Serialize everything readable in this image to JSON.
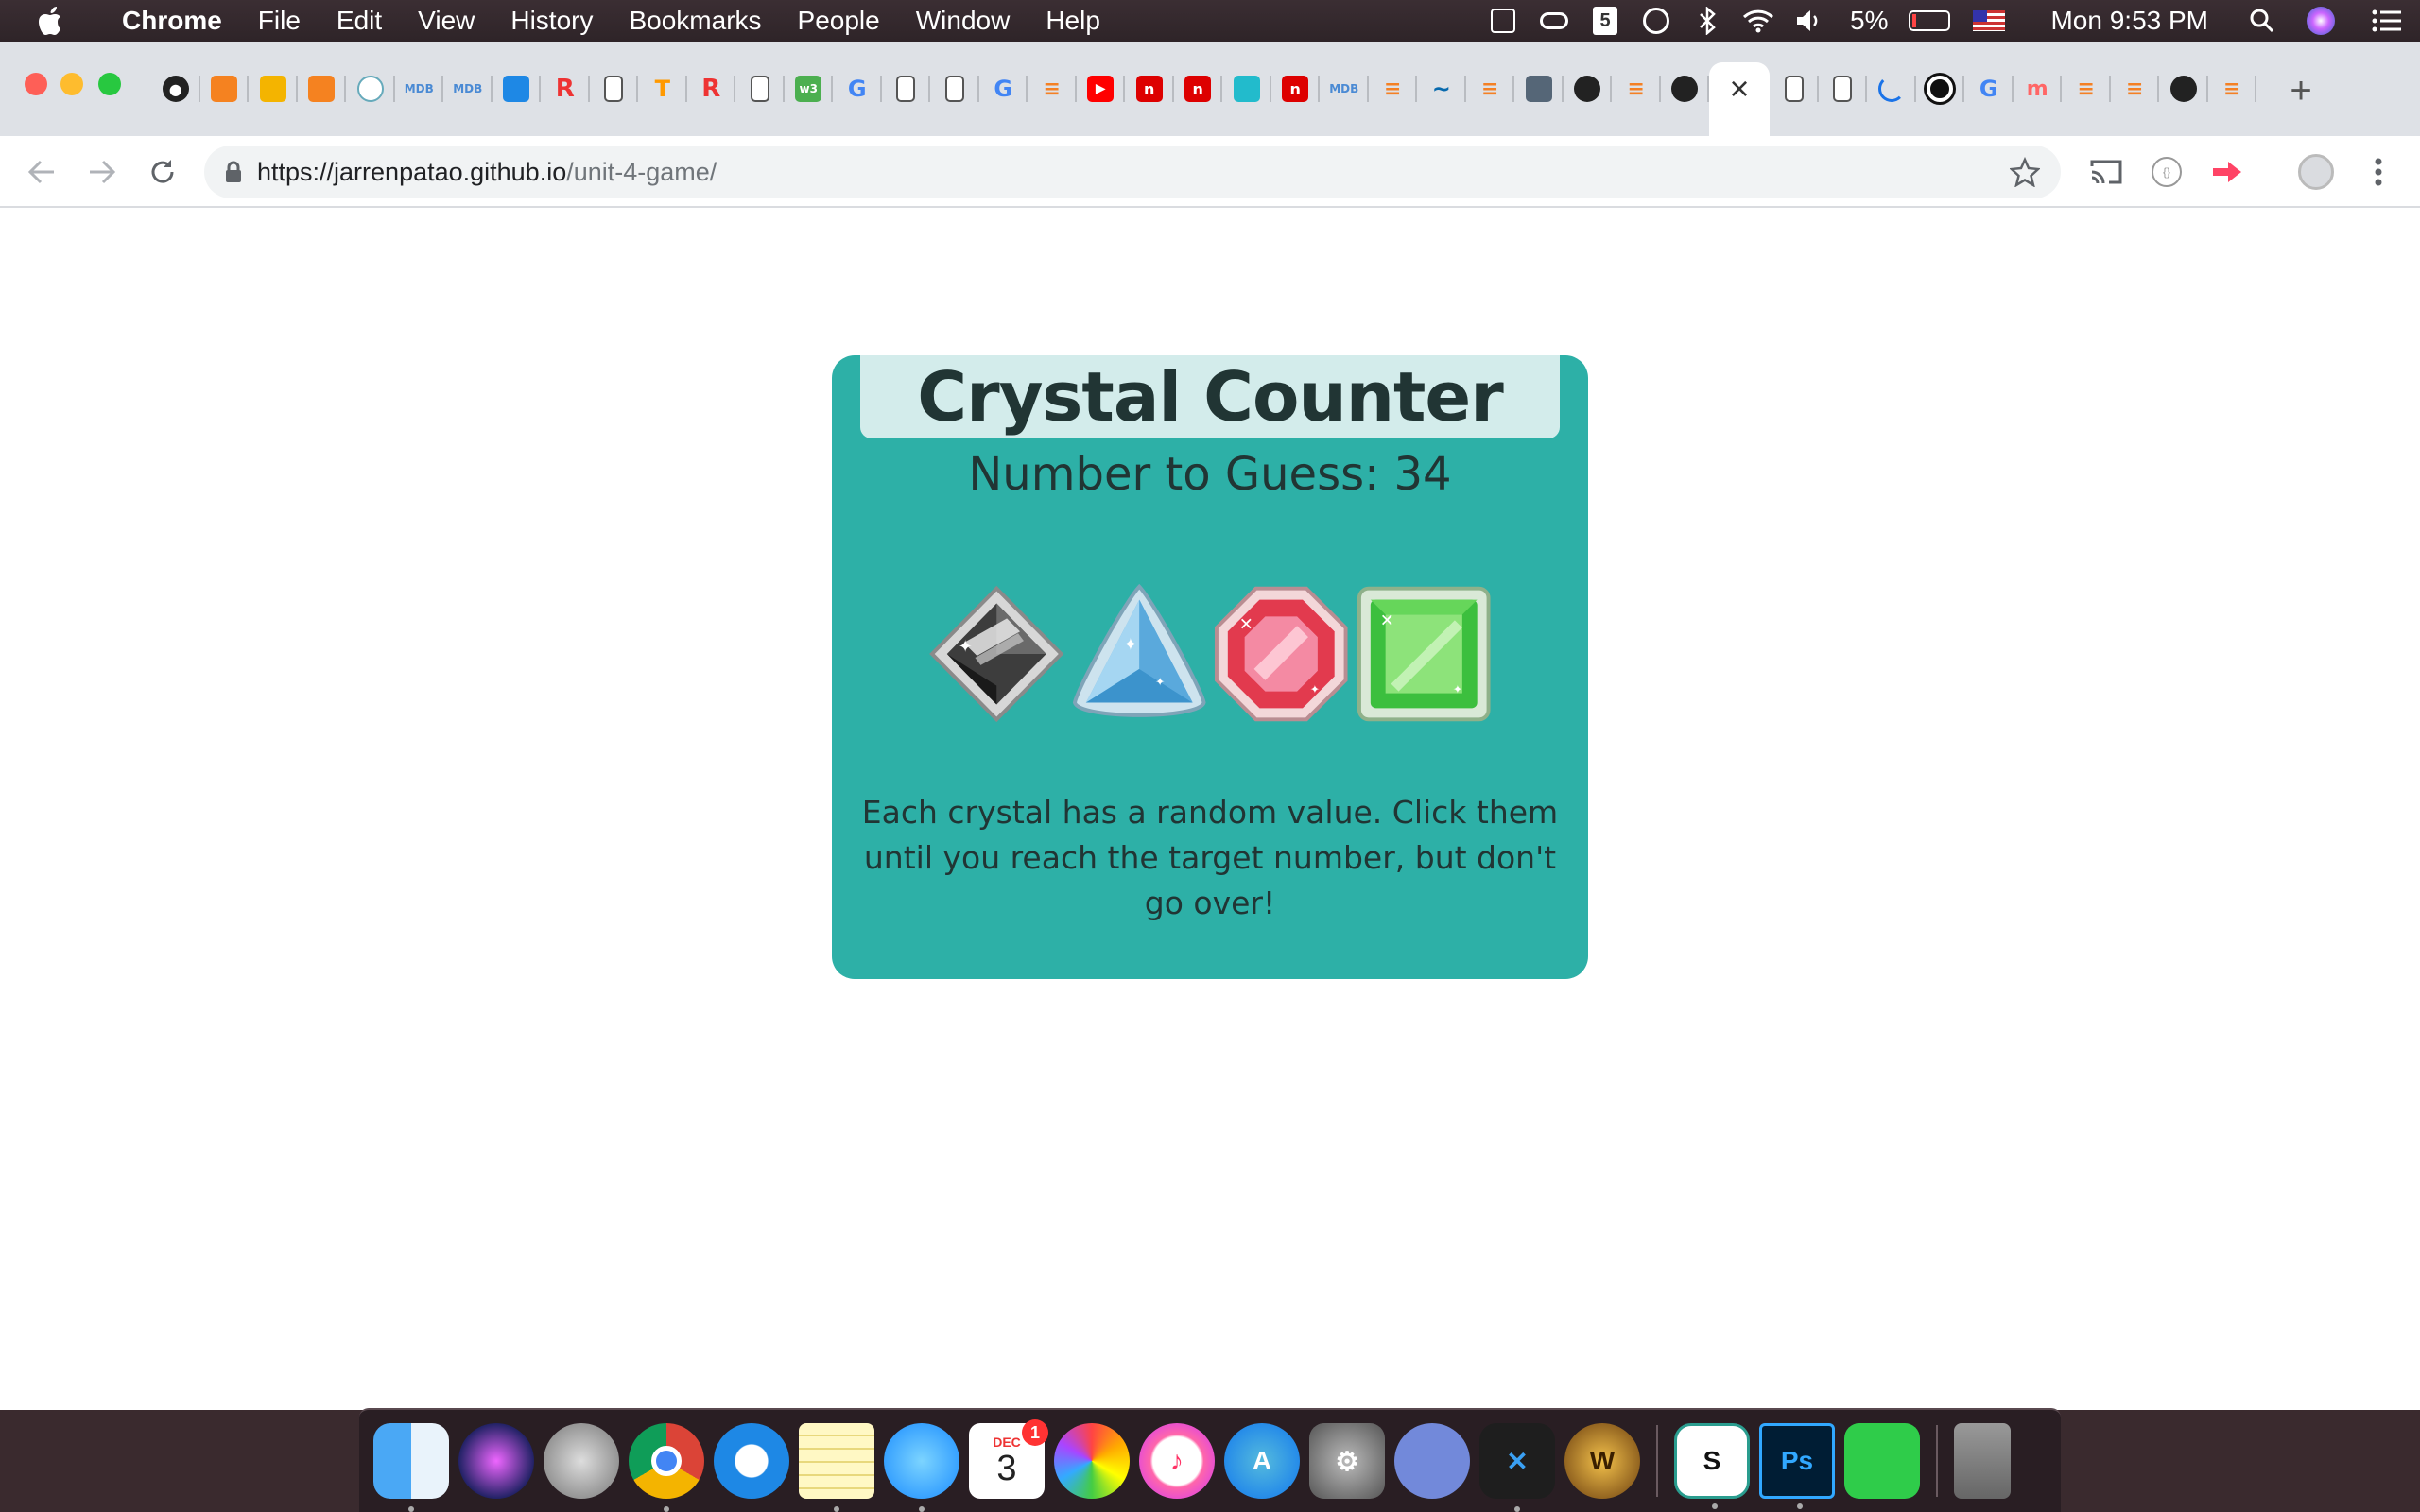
{
  "menubar": {
    "items": [
      "Chrome",
      "File",
      "Edit",
      "View",
      "History",
      "Bookmarks",
      "People",
      "Window",
      "Help"
    ],
    "battery": "5%",
    "clock": "Mon 9:53 PM"
  },
  "browser": {
    "url_host": "https://jarrenpatao.github.io",
    "url_path": "/unit-4-game/",
    "tab_close_symbol": "×",
    "new_tab_symbol": "+"
  },
  "game": {
    "title": "Crystal Counter",
    "number_label": "Number to Guess: 34",
    "instructions": "Each crystal has a random value. Click them until you reach the target number, but don't go over!",
    "crystals": [
      "black-crystal",
      "blue-crystal",
      "red-crystal",
      "green-crystal"
    ]
  },
  "dock": {
    "calendar_month": "DEC",
    "calendar_day": "3",
    "calendar_badge": "1"
  }
}
